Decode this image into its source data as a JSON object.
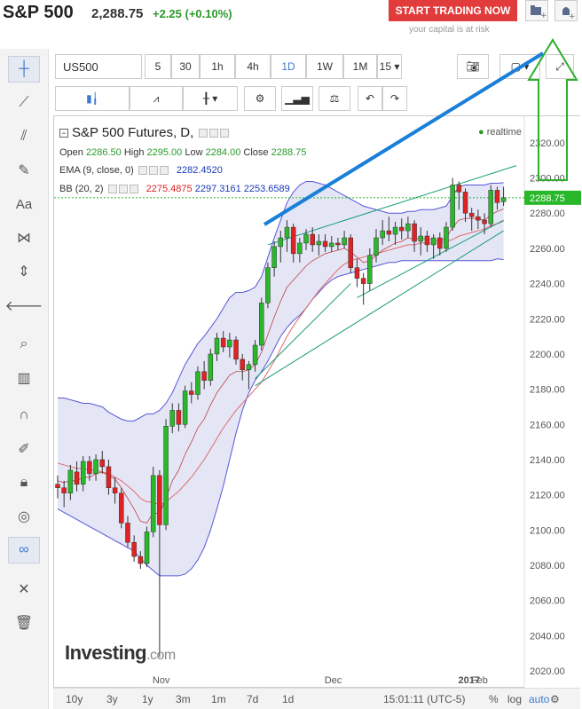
{
  "header": {
    "symbol": "S&P 500",
    "price": "2,288.75",
    "change": "+2.25 (+0.10%)",
    "trade_button": "START TRADING NOW",
    "risk_note": "your capital is at risk"
  },
  "toolbar": {
    "symbol_input": "US500",
    "intervals": [
      "5",
      "30",
      "1h",
      "4h",
      "1D",
      "1W",
      "1M",
      "15"
    ],
    "selected_interval": "1D"
  },
  "legend": {
    "title": "S&P 500 Futures, D,",
    "realtime": "realtime",
    "open_label": "Open",
    "open": "2286.50",
    "high_label": "High",
    "high": "2295.00",
    "low_label": "Low",
    "low": "2284.00",
    "close_label": "Close",
    "close": "2288.75",
    "ema_label": "EMA (9, close, 0)",
    "ema_value": "2282.4520",
    "bb_label": "BB (20, 2)",
    "bb_mid": "2275.4875",
    "bb_upper": "2297.3161",
    "bb_lower": "2253.6589"
  },
  "watermark": {
    "brand": "Investing",
    "suffix": ".com"
  },
  "bottom": {
    "ranges": [
      "10y",
      "3y",
      "1y",
      "3m",
      "1m",
      "7d",
      "1d"
    ],
    "time": "15:01:11 (UTC-5)",
    "percent": "%",
    "log": "log",
    "auto": "auto"
  },
  "colors": {
    "up": "#29b829",
    "down": "#e02222",
    "bb_band": "#5656d8",
    "bb_fill": "#d9dbf2",
    "ema": "#e06b6b",
    "trend": "#1a9b7a",
    "blue_line": "#1a7fd9",
    "arrow": "#2eae2e"
  },
  "chart_data": {
    "type": "candlestick",
    "title": "S&P 500 Futures, D,",
    "ylim": [
      2015,
      2330
    ],
    "y_ticks": [
      2020,
      2040,
      2060,
      2080,
      2100,
      2120,
      2140,
      2160,
      2180,
      2200,
      2220,
      2240,
      2260,
      2280,
      2300,
      2320
    ],
    "x_ticks": [
      "Nov",
      "Dec",
      "2017",
      "Feb"
    ],
    "last_price_label": "2288.75",
    "candles": [
      {
        "o": 2126,
        "h": 2131,
        "l": 2118,
        "c": 2124
      },
      {
        "o": 2124,
        "h": 2128,
        "l": 2113,
        "c": 2121
      },
      {
        "o": 2121,
        "h": 2137,
        "l": 2117,
        "c": 2134
      },
      {
        "o": 2133,
        "h": 2139,
        "l": 2122,
        "c": 2126
      },
      {
        "o": 2126,
        "h": 2142,
        "l": 2122,
        "c": 2139
      },
      {
        "o": 2139,
        "h": 2142,
        "l": 2128,
        "c": 2132
      },
      {
        "o": 2132,
        "h": 2143,
        "l": 2128,
        "c": 2140
      },
      {
        "o": 2140,
        "h": 2145,
        "l": 2132,
        "c": 2136
      },
      {
        "o": 2136,
        "h": 2140,
        "l": 2120,
        "c": 2124
      },
      {
        "o": 2124,
        "h": 2130,
        "l": 2115,
        "c": 2121
      },
      {
        "o": 2121,
        "h": 2124,
        "l": 2101,
        "c": 2104
      },
      {
        "o": 2104,
        "h": 2108,
        "l": 2090,
        "c": 2093
      },
      {
        "o": 2093,
        "h": 2097,
        "l": 2082,
        "c": 2085
      },
      {
        "o": 2085,
        "h": 2088,
        "l": 2078,
        "c": 2081
      },
      {
        "o": 2081,
        "h": 2102,
        "l": 2079,
        "c": 2099
      },
      {
        "o": 2099,
        "h": 2136,
        "l": 2096,
        "c": 2131
      },
      {
        "o": 2131,
        "h": 2134,
        "l": 2028,
        "c": 2103
      },
      {
        "o": 2103,
        "h": 2163,
        "l": 2100,
        "c": 2159
      },
      {
        "o": 2159,
        "h": 2172,
        "l": 2155,
        "c": 2168
      },
      {
        "o": 2168,
        "h": 2172,
        "l": 2156,
        "c": 2160
      },
      {
        "o": 2160,
        "h": 2182,
        "l": 2158,
        "c": 2179
      },
      {
        "o": 2179,
        "h": 2184,
        "l": 2172,
        "c": 2177
      },
      {
        "o": 2177,
        "h": 2193,
        "l": 2174,
        "c": 2190
      },
      {
        "o": 2190,
        "h": 2196,
        "l": 2180,
        "c": 2185
      },
      {
        "o": 2185,
        "h": 2203,
        "l": 2182,
        "c": 2200
      },
      {
        "o": 2200,
        "h": 2212,
        "l": 2196,
        "c": 2209
      },
      {
        "o": 2209,
        "h": 2213,
        "l": 2201,
        "c": 2204
      },
      {
        "o": 2204,
        "h": 2212,
        "l": 2198,
        "c": 2208
      },
      {
        "o": 2208,
        "h": 2210,
        "l": 2194,
        "c": 2197
      },
      {
        "o": 2197,
        "h": 2200,
        "l": 2185,
        "c": 2191
      },
      {
        "o": 2191,
        "h": 2196,
        "l": 2180,
        "c": 2194
      },
      {
        "o": 2194,
        "h": 2208,
        "l": 2190,
        "c": 2205
      },
      {
        "o": 2205,
        "h": 2232,
        "l": 2202,
        "c": 2229
      },
      {
        "o": 2229,
        "h": 2252,
        "l": 2226,
        "c": 2249
      },
      {
        "o": 2249,
        "h": 2264,
        "l": 2244,
        "c": 2261
      },
      {
        "o": 2261,
        "h": 2270,
        "l": 2252,
        "c": 2266
      },
      {
        "o": 2266,
        "h": 2276,
        "l": 2258,
        "c": 2272
      },
      {
        "o": 2272,
        "h": 2274,
        "l": 2252,
        "c": 2257
      },
      {
        "o": 2257,
        "h": 2266,
        "l": 2252,
        "c": 2263
      },
      {
        "o": 2263,
        "h": 2271,
        "l": 2259,
        "c": 2268
      },
      {
        "o": 2268,
        "h": 2272,
        "l": 2258,
        "c": 2262
      },
      {
        "o": 2262,
        "h": 2268,
        "l": 2256,
        "c": 2264
      },
      {
        "o": 2264,
        "h": 2268,
        "l": 2258,
        "c": 2261
      },
      {
        "o": 2261,
        "h": 2267,
        "l": 2258,
        "c": 2263
      },
      {
        "o": 2263,
        "h": 2266,
        "l": 2259,
        "c": 2262
      },
      {
        "o": 2262,
        "h": 2270,
        "l": 2260,
        "c": 2266
      },
      {
        "o": 2266,
        "h": 2268,
        "l": 2246,
        "c": 2249
      },
      {
        "o": 2249,
        "h": 2254,
        "l": 2238,
        "c": 2243
      },
      {
        "o": 2243,
        "h": 2246,
        "l": 2228,
        "c": 2240
      },
      {
        "o": 2240,
        "h": 2260,
        "l": 2236,
        "c": 2256
      },
      {
        "o": 2256,
        "h": 2271,
        "l": 2252,
        "c": 2266
      },
      {
        "o": 2266,
        "h": 2276,
        "l": 2262,
        "c": 2270
      },
      {
        "o": 2270,
        "h": 2278,
        "l": 2264,
        "c": 2268
      },
      {
        "o": 2268,
        "h": 2275,
        "l": 2262,
        "c": 2272
      },
      {
        "o": 2272,
        "h": 2277,
        "l": 2265,
        "c": 2270
      },
      {
        "o": 2270,
        "h": 2278,
        "l": 2266,
        "c": 2274
      },
      {
        "o": 2274,
        "h": 2276,
        "l": 2258,
        "c": 2264
      },
      {
        "o": 2264,
        "h": 2272,
        "l": 2256,
        "c": 2267
      },
      {
        "o": 2267,
        "h": 2270,
        "l": 2258,
        "c": 2262
      },
      {
        "o": 2262,
        "h": 2268,
        "l": 2254,
        "c": 2266
      },
      {
        "o": 2266,
        "h": 2269,
        "l": 2256,
        "c": 2260
      },
      {
        "o": 2260,
        "h": 2275,
        "l": 2258,
        "c": 2272
      },
      {
        "o": 2272,
        "h": 2300,
        "l": 2270,
        "c": 2296
      },
      {
        "o": 2296,
        "h": 2298,
        "l": 2282,
        "c": 2292
      },
      {
        "o": 2292,
        "h": 2294,
        "l": 2275,
        "c": 2280
      },
      {
        "o": 2280,
        "h": 2283,
        "l": 2270,
        "c": 2278
      },
      {
        "o": 2278,
        "h": 2282,
        "l": 2271,
        "c": 2276
      },
      {
        "o": 2276,
        "h": 2280,
        "l": 2268,
        "c": 2274
      },
      {
        "o": 2274,
        "h": 2296,
        "l": 2272,
        "c": 2293
      },
      {
        "o": 2293,
        "h": 2295,
        "l": 2282,
        "c": 2286
      },
      {
        "o": 2286.5,
        "h": 2295,
        "l": 2284,
        "c": 2288.75
      }
    ],
    "ema": [
      2128,
      2127,
      2128,
      2128,
      2130,
      2130,
      2132,
      2133,
      2131,
      2129,
      2124,
      2118,
      2112,
      2105,
      2104,
      2110,
      2109,
      2118,
      2128,
      2134,
      2143,
      2150,
      2158,
      2163,
      2171,
      2178,
      2183,
      2188,
      2190,
      2190,
      2191,
      2194,
      2201,
      2211,
      2221,
      2230,
      2238,
      2242,
      2246,
      2250,
      2253,
      2255,
      2257,
      2258,
      2259,
      2260,
      2258,
      2255,
      2252,
      2253,
      2256,
      2259,
      2261,
      2263,
      2264,
      2266,
      2265,
      2266,
      2265,
      2265,
      2264,
      2266,
      2272,
      2276,
      2277,
      2277,
      2277,
      2276,
      2279,
      2281,
      2282.45
    ],
    "bb_mid": [
      2138,
      2137,
      2136,
      2135,
      2135,
      2134,
      2134,
      2133,
      2132,
      2130,
      2128,
      2125,
      2122,
      2118,
      2116,
      2116,
      2114,
      2116,
      2119,
      2122,
      2126,
      2130,
      2135,
      2140,
      2146,
      2152,
      2158,
      2163,
      2168,
      2172,
      2176,
      2180,
      2184,
      2190,
      2196,
      2203,
      2210,
      2216,
      2221,
      2226,
      2231,
      2236,
      2240,
      2244,
      2248,
      2251,
      2253,
      2254,
      2255,
      2256,
      2257,
      2258,
      2259,
      2260,
      2261,
      2262,
      2262,
      2263,
      2263,
      2263,
      2263,
      2264,
      2265,
      2267,
      2268,
      2269,
      2270,
      2271,
      2273,
      2274,
      2275.49
    ],
    "bb_upper": [
      2175,
      2175,
      2174,
      2173,
      2172,
      2172,
      2171,
      2170,
      2167,
      2165,
      2163,
      2162,
      2162,
      2164,
      2166,
      2166,
      2168,
      2172,
      2178,
      2186,
      2194,
      2200,
      2206,
      2210,
      2215,
      2220,
      2226,
      2232,
      2235,
      2235,
      2236,
      2238,
      2244,
      2255,
      2266,
      2276,
      2286,
      2292,
      2296,
      2298,
      2298,
      2297,
      2296,
      2294,
      2292,
      2290,
      2288,
      2286,
      2284,
      2283,
      2282,
      2281,
      2280,
      2280,
      2280,
      2281,
      2281,
      2282,
      2282,
      2282,
      2283,
      2284,
      2290,
      2295,
      2296,
      2296,
      2296,
      2296,
      2297,
      2297,
      2297.32
    ],
    "bb_lower": [
      2112,
      2110,
      2108,
      2106,
      2104,
      2102,
      2100,
      2098,
      2096,
      2094,
      2092,
      2090,
      2088,
      2084,
      2080,
      2077,
      2074,
      2074,
      2074,
      2074,
      2075,
      2078,
      2083,
      2090,
      2100,
      2112,
      2125,
      2140,
      2155,
      2168,
      2178,
      2185,
      2190,
      2196,
      2203,
      2210,
      2215,
      2219,
      2222,
      2226,
      2231,
      2235,
      2239,
      2242,
      2244,
      2245,
      2246,
      2247,
      2248,
      2249,
      2250,
      2251,
      2252,
      2252,
      2253,
      2253,
      2253,
      2253,
      2253,
      2253,
      2253,
      2253,
      2253,
      2253,
      2253,
      2253,
      2253,
      2253,
      2253,
      2254,
      2253.66
    ]
  }
}
